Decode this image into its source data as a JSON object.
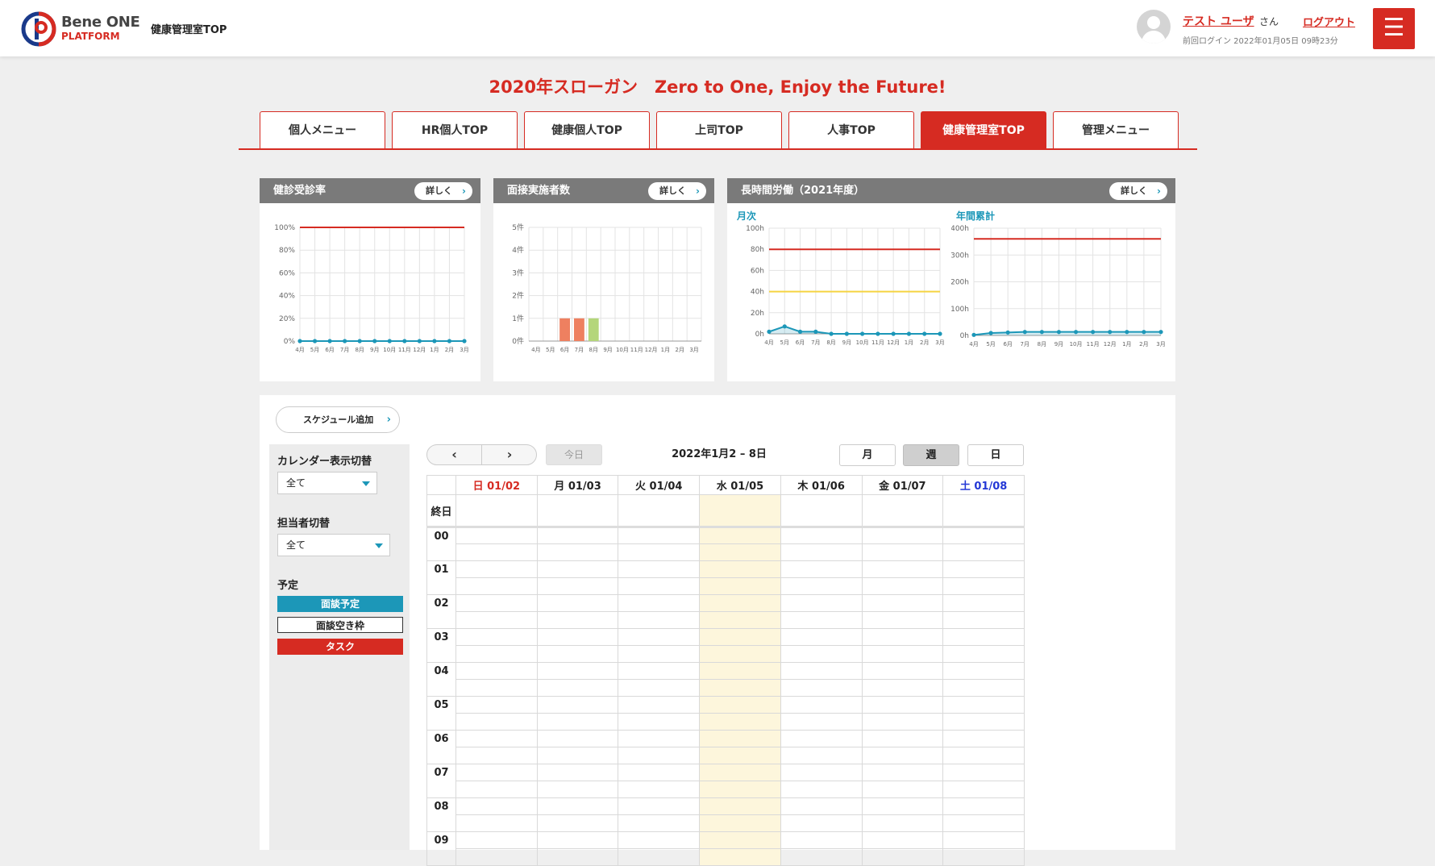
{
  "header": {
    "brand_name": "Bene ONE",
    "brand_sub": "PLATFORM",
    "breadcrumb": "健康管理室TOP",
    "user_name": "テスト ユーザ",
    "user_suffix": "さん",
    "logout": "ログアウト",
    "last_login": "前回ログイン  2022年01月05日 09時23分",
    "menu_icon": "☰"
  },
  "slogan": "2020年スローガン　Zero to One, Enjoy the Future!",
  "tabs": [
    {
      "label": "個人メニュー",
      "active": false
    },
    {
      "label": "HR個人TOP",
      "active": false
    },
    {
      "label": "健康個人TOP",
      "active": false
    },
    {
      "label": "上司TOP",
      "active": false
    },
    {
      "label": "人事TOP",
      "active": false
    },
    {
      "label": "健康管理室TOP",
      "active": true
    },
    {
      "label": "管理メニュー",
      "active": false
    }
  ],
  "cards": {
    "detail_label": "詳しく",
    "checkup": {
      "title": "健診受診率"
    },
    "interview": {
      "title": "面接実施者数"
    },
    "overtime": {
      "title": "長時間労働（2021年度）",
      "monthly_label": "月次",
      "annual_label": "年間累計"
    }
  },
  "chart_data": [
    {
      "type": "line",
      "title": "健診受診率",
      "categories": [
        "4月",
        "5月",
        "6月",
        "7月",
        "8月",
        "9月",
        "10月",
        "11月",
        "12月",
        "1月",
        "2月",
        "3月"
      ],
      "y_ticks": [
        "0%",
        "20%",
        "40%",
        "60%",
        "80%",
        "100%"
      ],
      "ylim": [
        0,
        100
      ],
      "series": [
        {
          "values": [
            0,
            0,
            0,
            0,
            0,
            0,
            0,
            0,
            0,
            0,
            0,
            0
          ],
          "color": "#1c97b8"
        }
      ],
      "reference_lines": [
        {
          "value": 100,
          "color": "#d62b22"
        }
      ]
    },
    {
      "type": "bar",
      "title": "面接実施者数",
      "categories": [
        "4月",
        "5月",
        "6月",
        "7月",
        "8月",
        "9月",
        "10月",
        "11月",
        "12月",
        "1月",
        "2月",
        "3月"
      ],
      "y_ticks": [
        "0件",
        "1件",
        "2件",
        "3件",
        "4件",
        "5件"
      ],
      "ylim": [
        0,
        5
      ],
      "values": [
        0,
        0,
        1,
        1,
        1,
        0,
        0,
        0,
        0,
        0,
        0,
        0
      ],
      "bar_colors": [
        "#ee8060",
        "#ee8060",
        "#ee8060",
        "#ee8060",
        "#b4d67a",
        "#ee8060",
        "#ee8060",
        "#ee8060",
        "#ee8060",
        "#ee8060",
        "#ee8060",
        "#ee8060"
      ]
    },
    {
      "type": "line",
      "title": "月次",
      "categories": [
        "4月",
        "5月",
        "6月",
        "7月",
        "8月",
        "9月",
        "10月",
        "11月",
        "12月",
        "1月",
        "2月",
        "3月"
      ],
      "y_ticks": [
        "0h",
        "20h",
        "40h",
        "60h",
        "80h",
        "100h"
      ],
      "ylim": [
        0,
        100
      ],
      "series": [
        {
          "values": [
            2,
            7,
            2,
            2,
            0,
            0,
            0,
            0,
            0,
            0,
            0,
            0
          ],
          "color": "#1c97b8"
        }
      ],
      "reference_lines": [
        {
          "value": 80,
          "color": "#d62b22"
        },
        {
          "value": 40,
          "color": "#f5d442"
        }
      ]
    },
    {
      "type": "line",
      "title": "年間累計",
      "categories": [
        "4月",
        "5月",
        "6月",
        "7月",
        "8月",
        "9月",
        "10月",
        "11月",
        "12月",
        "1月",
        "2月",
        "3月"
      ],
      "y_ticks": [
        "0h",
        "100h",
        "200h",
        "300h",
        "400h"
      ],
      "ylim": [
        0,
        400
      ],
      "series": [
        {
          "values": [
            2,
            9,
            11,
            13,
            13,
            13,
            13,
            13,
            13,
            13,
            13,
            13
          ],
          "color": "#1c97b8"
        }
      ],
      "reference_lines": [
        {
          "value": 360,
          "color": "#d62b22"
        }
      ]
    }
  ],
  "schedule": {
    "add_button": "スケジュール追加",
    "calendar_switch_label": "カレンダー表示切替",
    "calendar_switch_value": "全て",
    "owner_switch_label": "担当者切替",
    "owner_switch_value": "全て",
    "legend_label": "予定",
    "legend": [
      {
        "label": "面談予定",
        "color": "#1c97b8"
      },
      {
        "label": "面談空き枠",
        "color": "#ffffff"
      },
      {
        "label": "タスク",
        "color": "#d62b22"
      }
    ],
    "prev": "‹",
    "next": "›",
    "today": "今日",
    "range": "2022年1月2 – 8日",
    "views": [
      "月",
      "週",
      "日"
    ],
    "active_view": "週",
    "days": [
      "日 01/02",
      "月 01/03",
      "火 01/04",
      "水 01/05",
      "木 01/06",
      "金 01/07",
      "土 01/08"
    ],
    "allday": "終日",
    "hours": [
      "00",
      "01",
      "02",
      "03",
      "04",
      "05",
      "06",
      "07",
      "08",
      "09"
    ]
  }
}
